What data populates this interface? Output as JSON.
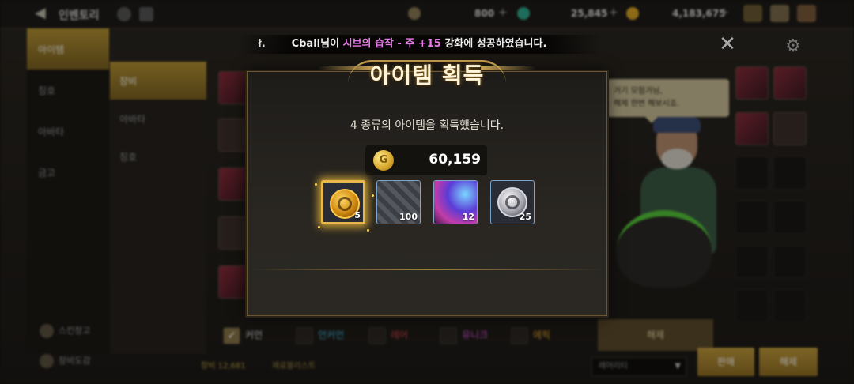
{
  "topbar": {
    "title": "인벤토리",
    "currency_1": "800",
    "currency_2": "25,845",
    "currency_3": "4,183,675"
  },
  "left_nav": [
    "아이템",
    "칭호",
    "아바타",
    "금고"
  ],
  "sub_nav": [
    "장비",
    "아바타",
    "칭호"
  ],
  "bottom_links": [
    "스킨창고",
    "장비도감"
  ],
  "notice": {
    "lead": "ł.",
    "player": "Cball",
    "suffix_1": "님이 ",
    "item": "시브의 습작 - 주 +15",
    "suffix_2": " 강화에 성공하였습니다."
  },
  "npc_speech": [
    "거기 모험가님,",
    "해제 한번 해보시죠."
  ],
  "filters": [
    "커먼",
    "언커먼",
    "레어",
    "유니크",
    "에픽"
  ],
  "filter_colors": [
    "#dddddd",
    "#3fb6d8",
    "#d8424a",
    "#d85ad8",
    "#e0a030"
  ],
  "buttons": {
    "release": "해제",
    "sell": "판매",
    "release_2": "해제"
  },
  "dropdown": {
    "value": "레어리티"
  },
  "bottom_info": {
    "label": "장비 12,681",
    "wishlist": "재료블리스트"
  },
  "modal": {
    "title": "아이템 획득",
    "message": "4 종류의 아이템을 획득했습니다.",
    "gold_symbol": "G",
    "gold_amount": "60,159",
    "rewards": [
      {
        "icon": "gold-emblem-icon",
        "count": "5",
        "selected": true
      },
      {
        "icon": "cube-material-icon",
        "count": "100",
        "selected": false
      },
      {
        "icon": "potion-icon",
        "count": "12",
        "selected": false
      },
      {
        "icon": "silver-emblem-icon",
        "count": "25",
        "selected": false
      }
    ]
  },
  "colors": {
    "accent_gold": "#c9a556",
    "highlight_pink": "#e47ae8",
    "bg": "#1e1c19"
  }
}
